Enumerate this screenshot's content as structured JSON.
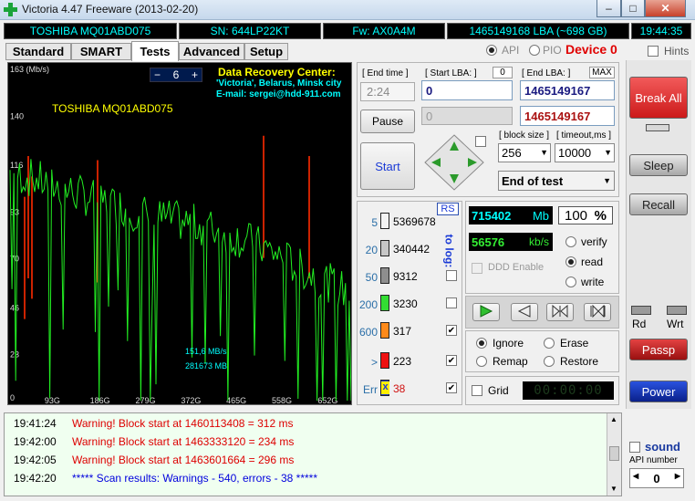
{
  "window": {
    "title": "Victoria 4.47  Freeware (2013-02-20)",
    "minimize": "–",
    "maximize": "□",
    "close": "✕"
  },
  "infobar": {
    "model": "TOSHIBA MQ01ABD075",
    "serial": "SN: 644LP22KT",
    "firmware": "Fw: AX0A4M",
    "capacity": "1465149168 LBA (~698 GB)",
    "time": "19:44:35"
  },
  "tabs": [
    {
      "label": "Standard"
    },
    {
      "label": "SMART"
    },
    {
      "label": "Tests"
    },
    {
      "label": "Advanced"
    },
    {
      "label": "Setup"
    }
  ],
  "mode": {
    "api": "API",
    "pio": "PIO",
    "device": "Device 0",
    "hints": "Hints"
  },
  "graph": {
    "ymax_label": "163 (Mb/s)",
    "scale_value": "6",
    "scale_minus": "−",
    "scale_plus": "+",
    "banner_line1": "Data Recovery Center:",
    "banner_line2": "'Victoria', Belarus, Minsk city",
    "banner_line3": "E-mail: sergei@hdd-911.com",
    "drive_label": "TOSHIBA MQ01ABD075",
    "speed_readout": "151,6 MB/s",
    "position_readout": "281673 MB",
    "colors": {
      "background": "#000000",
      "curve": "#22ee22",
      "error_marks": "#cc2200",
      "grid_text": "#dddddd"
    }
  },
  "chart_data": {
    "type": "line",
    "title": "",
    "xlabel": "",
    "ylabel": "(Mb/s)",
    "ylim": [
      0,
      163
    ],
    "yticks": [
      "163 (Mb/s)",
      "140",
      "116",
      "93",
      "70",
      "46",
      "23",
      "0"
    ],
    "xticks": [
      "93G",
      "186G",
      "279G",
      "372G",
      "465G",
      "558G",
      "652G"
    ],
    "series": [
      {
        "x": [
          0,
          30,
          60,
          93,
          130,
          186,
          230,
          279,
          320,
          372,
          420,
          465,
          510,
          558,
          600,
          652,
          698
        ],
        "y": [
          112,
          110,
          108,
          105,
          102,
          98,
          95,
          91,
          89,
          87,
          84,
          80,
          76,
          70,
          64,
          58,
          52
        ]
      }
    ]
  },
  "test": {
    "end_time_label": "[ End time ]",
    "end_time_value": "2:24",
    "start_lba_label": "[ Start LBA: ]",
    "start_lba_zero": "0",
    "end_lba_label": "[ End LBA: ]",
    "end_lba_max": "MAX",
    "start_lba": "0",
    "end_lba": "1465149167",
    "pos_field": "0",
    "pos_lba": "1465149167",
    "pause": "Pause",
    "start": "Start",
    "block_size_label": "[ block size ]",
    "timeout_label": "[ timeout,ms ]",
    "block_size": "256",
    "timeout": "10000",
    "end_action": "End of test"
  },
  "counters": {
    "rs": "RS",
    "to_log": "to log:",
    "rows": [
      {
        "threshold": "5",
        "count": "5369678",
        "color": "#f3f3f3",
        "logged": false
      },
      {
        "threshold": "20",
        "count": "340442",
        "color": "#c7c7c7",
        "logged": false
      },
      {
        "threshold": "50",
        "count": "9312",
        "color": "#8e8e8e",
        "logged": false
      },
      {
        "threshold": "200",
        "count": "3230",
        "color": "#33dd33",
        "logged": false
      },
      {
        "threshold": "600",
        "count": "317",
        "color": "#ff8a1a",
        "logged": true
      },
      {
        "threshold": ">",
        "count": "223",
        "color": "#ee1111",
        "logged": true
      },
      {
        "threshold": "Err",
        "count": "38",
        "color": "#1a3ad6",
        "logged": true
      }
    ],
    "err_mark": "x",
    "checkmark": "✔"
  },
  "stats": {
    "mb_value": "715402",
    "mb_unit": "Mb",
    "percent": "100",
    "percent_unit": "%",
    "speed_value": "56576",
    "speed_unit": "kb/s",
    "ddd": "DDD Enable",
    "verify": "verify",
    "read": "read",
    "write": "write"
  },
  "actions": {
    "ignore": "Ignore",
    "erase": "Erase",
    "remap": "Remap",
    "restore": "Restore",
    "grid": "Grid",
    "timer": "00:00:00"
  },
  "right": {
    "break_all": "Break All",
    "sleep": "Sleep",
    "recall": "Recall",
    "rd": "Rd",
    "wrt": "Wrt",
    "passp": "Passp",
    "power": "Power",
    "sound": "sound",
    "api_number": "API number",
    "api_value": "0"
  },
  "log": [
    {
      "time": "19:41:24",
      "text": "Warning! Block start at 1460113408 = 312 ms",
      "color": "#dd0000"
    },
    {
      "time": "19:42:00",
      "text": "Warning! Block start at 1463333120 = 234 ms",
      "color": "#dd0000"
    },
    {
      "time": "19:42:05",
      "text": "Warning! Block start at 1463601664 = 296 ms",
      "color": "#dd0000"
    },
    {
      "time": "19:42:20",
      "text": "***** Scan results: Warnings - 540, errors - 38 *****",
      "color": "#0000dd"
    }
  ]
}
